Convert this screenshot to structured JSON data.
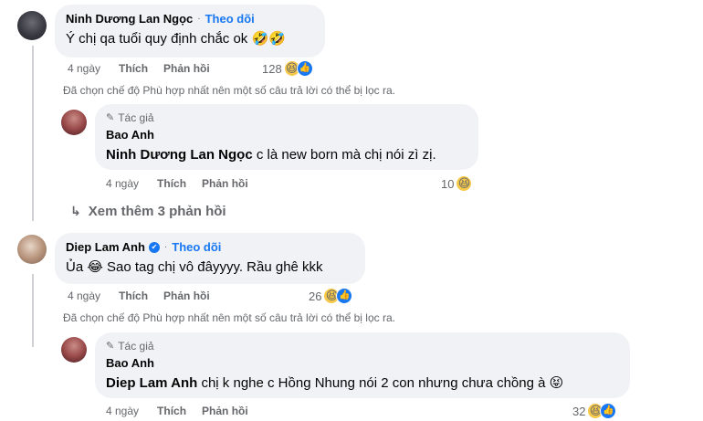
{
  "comment1": {
    "author": "Ninh Dương Lan Ngọc",
    "follow_label": "Theo dõi",
    "text": "Ý chị qa tuổi quy định chắc ok 🤣🤣",
    "age": "4 ngày",
    "like_label": "Thích",
    "reply_label": "Phản hồi",
    "reaction_count": "128",
    "filter_note": "Đã chọn chế độ Phù hợp nhất nên một số câu trả lời có thể bị lọc ra."
  },
  "reply1": {
    "author_badge": "Tác giả",
    "author": "Bao Anh",
    "mention": "Ninh Dương Lan Ngọc",
    "text": " c là new born mà chị nói zì zị.",
    "age": "4 ngày",
    "like_label": "Thích",
    "reply_label": "Phản hồi",
    "reaction_count": "10"
  },
  "view_more": {
    "label": "Xem thêm 3 phản hồi"
  },
  "comment2": {
    "author": "Diep Lam Anh",
    "follow_label": "Theo dõi",
    "text": "Ủa 😂 Sao tag chị vô đâyyyy. Rầu ghê kkk",
    "age": "4 ngày",
    "like_label": "Thích",
    "reply_label": "Phản hồi",
    "reaction_count": "26",
    "filter_note": "Đã chọn chế độ Phù hợp nhất nên một số câu trả lời có thể bị lọc ra."
  },
  "reply2": {
    "author_badge": "Tác giả",
    "author": "Bao Anh",
    "mention": "Diep Lam Anh",
    "text": " chị k nghe c Hồng Nhung nói 2 con nhưng chưa chồng à 😝",
    "age": "4 ngày",
    "like_label": "Thích",
    "reply_label": "Phản hồi",
    "reaction_count": "32"
  },
  "icons": {
    "haha": "😆",
    "like": "👍",
    "verified": "✔",
    "pen": "✎",
    "reply_arrow": "↳"
  }
}
